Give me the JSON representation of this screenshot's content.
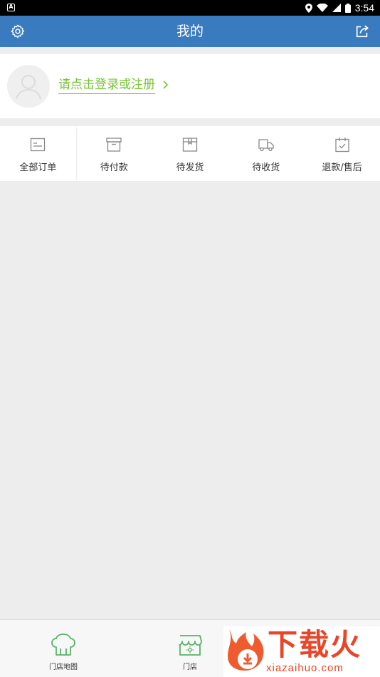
{
  "status_bar": {
    "left_icon": "A",
    "time": "3:54",
    "icons": [
      "location-icon",
      "wifi-icon",
      "signal-icon",
      "battery-icon"
    ]
  },
  "header": {
    "title": "我的",
    "left_icon": "gear-icon",
    "right_icon": "share-icon"
  },
  "profile": {
    "avatar_icon": "user-avatar-icon",
    "login_text": "请点击登录或注册",
    "chevron_icon": "chevron-right-icon"
  },
  "orders": {
    "items": [
      {
        "label": "全部订单",
        "icon": "order-list-icon"
      },
      {
        "label": "待付款",
        "icon": "payment-box-icon"
      },
      {
        "label": "待发货",
        "icon": "package-icon"
      },
      {
        "label": "待收货",
        "icon": "truck-icon"
      },
      {
        "label": "退款/售后",
        "icon": "calendar-check-icon"
      }
    ]
  },
  "bottom_nav": {
    "items": [
      {
        "label": "门店地图",
        "icon": "chef-hat-icon"
      },
      {
        "label": "门店",
        "icon": "store-icon"
      }
    ]
  },
  "watermark": {
    "text": "下载火",
    "domain": "xiazaihuo.com"
  },
  "colors": {
    "header_bg": "#3a7bbf",
    "accent_green": "#76c432",
    "page_bg": "#ededed",
    "watermark_red": "#e8462a"
  }
}
